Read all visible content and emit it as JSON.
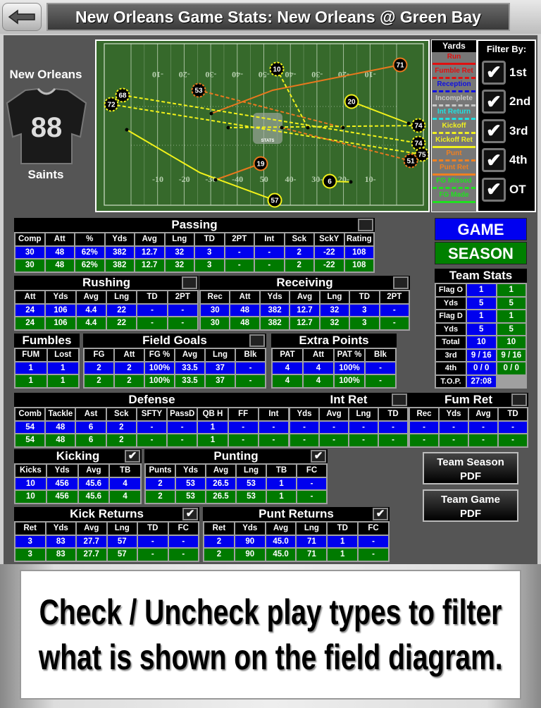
{
  "header": {
    "title": "New Orleans Game Stats: New Orleans @ Green Bay",
    "back_icon": "back-arrow-icon"
  },
  "team": {
    "name": "New Orleans",
    "jersey_number": "88",
    "nickname": "Saints"
  },
  "field": {
    "yard_labels_top": [
      "-10",
      "-20",
      "-30",
      "-40",
      "-50",
      "-40",
      "-30",
      "-20",
      "-10"
    ],
    "yard_labels_bottom": [
      "-10",
      "-20",
      "-30",
      "-40",
      "50",
      "40-",
      "30-",
      "20-",
      "10-"
    ],
    "logo_text": "STATS",
    "markers": [
      {
        "label": "71",
        "type": "Punt Ret"
      },
      {
        "label": "10",
        "type": "Kickoff"
      },
      {
        "label": "53",
        "type": "Punt"
      },
      {
        "label": "68",
        "type": "Kickoff"
      },
      {
        "label": "72",
        "type": "Kickoff"
      },
      {
        "label": "20",
        "type": "Kickoff Ret"
      },
      {
        "label": "74",
        "type": "Kickoff"
      },
      {
        "label": "74",
        "type": "Kickoff"
      },
      {
        "label": "75",
        "type": "Kickoff"
      },
      {
        "label": "51",
        "type": "Punt"
      },
      {
        "label": "19",
        "type": "Punt Ret"
      },
      {
        "label": "6",
        "type": "Kickoff Ret"
      },
      {
        "label": "57",
        "type": "Kickoff Ret"
      }
    ]
  },
  "legend": {
    "title": "Yards",
    "items": [
      {
        "label": "Run",
        "color": "#e01010",
        "style": "solid"
      },
      {
        "label": "Fumble Ret",
        "color": "#e01010",
        "style": "dashed"
      },
      {
        "label": "Reception",
        "color": "#1010e0",
        "style": "dashed"
      },
      {
        "label": "Incomplete",
        "color": "#c8c8c8",
        "style": "dashed"
      },
      {
        "label": "Int Return",
        "color": "#20e0e0",
        "style": "dashed"
      },
      {
        "label": "Kickoff",
        "color": "#f0f020",
        "style": "dashed"
      },
      {
        "label": "Kickoff Ret",
        "color": "#f0f020",
        "style": "solid"
      },
      {
        "label": "Punt",
        "color": "#f08020",
        "style": "dashed"
      },
      {
        "label": "Punt Ret",
        "color": "#f08020",
        "style": "solid"
      },
      {
        "label": "FG Missed",
        "color": "#20e020",
        "style": "dashed"
      },
      {
        "label": "FG Made",
        "color": "#20e020",
        "style": "solid"
      }
    ]
  },
  "filter": {
    "title": "Filter By:",
    "items": [
      {
        "label": "1st",
        "checked": true
      },
      {
        "label": "2nd",
        "checked": true
      },
      {
        "label": "3rd",
        "checked": true
      },
      {
        "label": "4th",
        "checked": true
      },
      {
        "label": "OT",
        "checked": true
      }
    ]
  },
  "view_buttons": {
    "game": "GAME",
    "season": "SEASON"
  },
  "tables": {
    "passing": {
      "title": "Passing",
      "checked": false,
      "headers": [
        "Comp",
        "Att",
        "%",
        "Yds",
        "Avg",
        "Lng",
        "TD",
        "2PT",
        "Int",
        "Sck",
        "SckY",
        "Rating"
      ],
      "game": [
        "30",
        "48",
        "62%",
        "382",
        "12.7",
        "32",
        "3",
        "-",
        "-",
        "2",
        "-22",
        "108"
      ],
      "season": [
        "30",
        "48",
        "62%",
        "382",
        "12.7",
        "32",
        "3",
        "-",
        "-",
        "2",
        "-22",
        "108"
      ]
    },
    "rushing": {
      "title": "Rushing",
      "checked": false,
      "headers": [
        "Att",
        "Yds",
        "Avg",
        "Lng",
        "TD",
        "2PT"
      ],
      "game": [
        "24",
        "106",
        "4.4",
        "22",
        "-",
        "-"
      ],
      "season": [
        "24",
        "106",
        "4.4",
        "22",
        "-",
        "-"
      ]
    },
    "receiving": {
      "title": "Receiving",
      "checked": false,
      "headers": [
        "Rec",
        "Att",
        "Yds",
        "Avg",
        "Lng",
        "TD",
        "2PT"
      ],
      "game": [
        "30",
        "48",
        "382",
        "12.7",
        "32",
        "3",
        "-"
      ],
      "season": [
        "30",
        "48",
        "382",
        "12.7",
        "32",
        "3",
        "-"
      ]
    },
    "fumbles": {
      "title": "Fumbles",
      "headers": [
        "FUM",
        "Lost"
      ],
      "game": [
        "1",
        "1"
      ],
      "season": [
        "1",
        "1"
      ]
    },
    "field_goals": {
      "title": "Field Goals",
      "checked": false,
      "headers": [
        "FG",
        "Att",
        "FG %",
        "Avg",
        "Lng",
        "Blk"
      ],
      "game": [
        "2",
        "2",
        "100%",
        "33.5",
        "37",
        "-"
      ],
      "season": [
        "2",
        "2",
        "100%",
        "33.5",
        "37",
        "-"
      ]
    },
    "extra_points": {
      "title": "Extra Points",
      "headers": [
        "PAT",
        "Att",
        "PAT %",
        "Blk"
      ],
      "game": [
        "4",
        "4",
        "100%",
        "-"
      ],
      "season": [
        "4",
        "4",
        "100%",
        "-"
      ]
    },
    "defense": {
      "title": "Defense",
      "headers": [
        "Comb",
        "Tackle",
        "Ast",
        "Sck",
        "SFTY",
        "PassD",
        "QB H",
        "FF",
        "Int"
      ],
      "game": [
        "54",
        "48",
        "6",
        "2",
        "-",
        "-",
        "1",
        "-",
        "-"
      ],
      "season": [
        "54",
        "48",
        "6",
        "2",
        "-",
        "-",
        "1",
        "-",
        "-"
      ]
    },
    "int_ret": {
      "title": "Int Ret",
      "checked": false,
      "headers": [
        "Yds",
        "Avg",
        "Lng",
        "TD"
      ],
      "game": [
        "-",
        "-",
        "-",
        "-"
      ],
      "season": [
        "-",
        "-",
        "-",
        "-"
      ]
    },
    "fum_ret": {
      "title": "Fum Ret",
      "checked": false,
      "headers": [
        "Rec",
        "Yds",
        "Avg",
        "TD"
      ],
      "game": [
        "-",
        "-",
        "-",
        "-"
      ],
      "season": [
        "-",
        "-",
        "-",
        "-"
      ]
    },
    "kicking": {
      "title": "Kicking",
      "checked": true,
      "headers": [
        "Kicks",
        "Yds",
        "Avg",
        "TB"
      ],
      "game": [
        "10",
        "456",
        "45.6",
        "4"
      ],
      "season": [
        "10",
        "456",
        "45.6",
        "4"
      ]
    },
    "punting": {
      "title": "Punting",
      "checked": true,
      "headers": [
        "Punts",
        "Yds",
        "Avg",
        "Lng",
        "TB",
        "FC"
      ],
      "game": [
        "2",
        "53",
        "26.5",
        "53",
        "1",
        "-"
      ],
      "season": [
        "2",
        "53",
        "26.5",
        "53",
        "1",
        "-"
      ]
    },
    "kick_returns": {
      "title": "Kick Returns",
      "checked": true,
      "headers": [
        "Ret",
        "Yds",
        "Avg",
        "Lng",
        "TD",
        "FC"
      ],
      "game": [
        "3",
        "83",
        "27.7",
        "57",
        "-",
        "-"
      ],
      "season": [
        "3",
        "83",
        "27.7",
        "57",
        "-",
        "-"
      ]
    },
    "punt_returns": {
      "title": "Punt Returns",
      "checked": true,
      "headers": [
        "Ret",
        "Yds",
        "Avg",
        "Lng",
        "TD",
        "FC"
      ],
      "game": [
        "2",
        "90",
        "45.0",
        "71",
        "1",
        "-"
      ],
      "season": [
        "2",
        "90",
        "45.0",
        "71",
        "1",
        "-"
      ]
    }
  },
  "team_stats": {
    "title": "Team Stats",
    "rows": [
      {
        "label": "Flag O",
        "game": "1",
        "season": "1"
      },
      {
        "label": "Yds",
        "game": "5",
        "season": "5"
      },
      {
        "label": "Flag D",
        "game": "1",
        "season": "1"
      },
      {
        "label": "Yds",
        "game": "5",
        "season": "5"
      },
      {
        "label": "Total",
        "game": "10",
        "season": "10"
      },
      {
        "label": "3rd",
        "game": "9 / 16",
        "season": "9 / 16"
      },
      {
        "label": "4th",
        "game": "0 / 0",
        "season": "0 / 0"
      },
      {
        "label": "T.O.P.",
        "game": "27:08"
      }
    ]
  },
  "pdf_buttons": {
    "season": [
      "Team Season",
      "PDF"
    ],
    "game": [
      "Team Game",
      "PDF"
    ]
  },
  "banner": {
    "lines": [
      "Check / Uncheck play types to filter",
      "what is shown on the field diagram."
    ]
  },
  "colors": {
    "game_row": "#0000ee",
    "season_row": "#007a00",
    "panel": "#555555"
  }
}
